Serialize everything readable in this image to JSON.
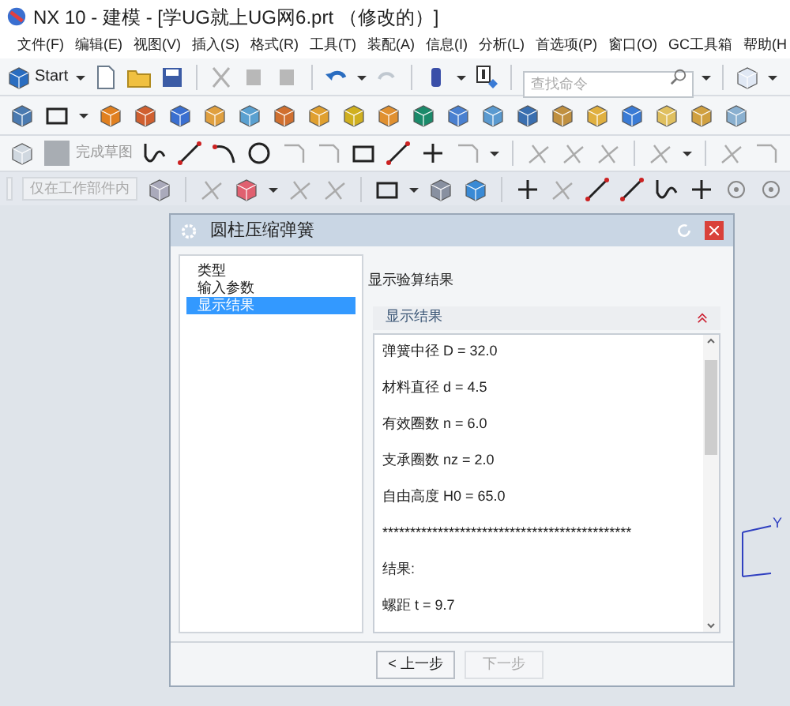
{
  "window": {
    "title": "NX 10 - 建模 - [学UG就上UG网6.prt （修改的）]"
  },
  "menu": [
    "文件(F)",
    "编辑(E)",
    "视图(V)",
    "插入(S)",
    "格式(R)",
    "工具(T)",
    "装配(A)",
    "信息(I)",
    "分析(L)",
    "首选项(P)",
    "窗口(O)",
    "GC工具箱",
    "帮助(H"
  ],
  "toolbar": {
    "start": "Start",
    "search": {
      "placeholder": "查找命令"
    }
  },
  "sketch_toolbar": {
    "finish": "完成草图"
  },
  "selection_bar": {
    "scope": "仅在工作部件内"
  },
  "dialog": {
    "title": "圆柱压缩弹簧",
    "steps": [
      {
        "label": "类型",
        "selected": false
      },
      {
        "label": "输入参数",
        "selected": false
      },
      {
        "label": "显示结果",
        "selected": true
      }
    ],
    "heading": "显示验算结果",
    "group": {
      "title": "显示结果",
      "expanded": true
    },
    "lines": [
      "弹簧中径 D = 32.0",
      "材料直径 d = 4.5",
      "有效圈数 n = 6.0",
      "支承圈数 nz = 2.0",
      "自由高度 H0 = 65.0",
      "*********************************************",
      "结果:",
      "螺距 t = 9.7"
    ],
    "buttons": [
      {
        "label": "< 上一步",
        "disabled": false
      },
      {
        "label": "下一步",
        "disabled": true
      }
    ]
  },
  "axis": {
    "label": "Y"
  }
}
